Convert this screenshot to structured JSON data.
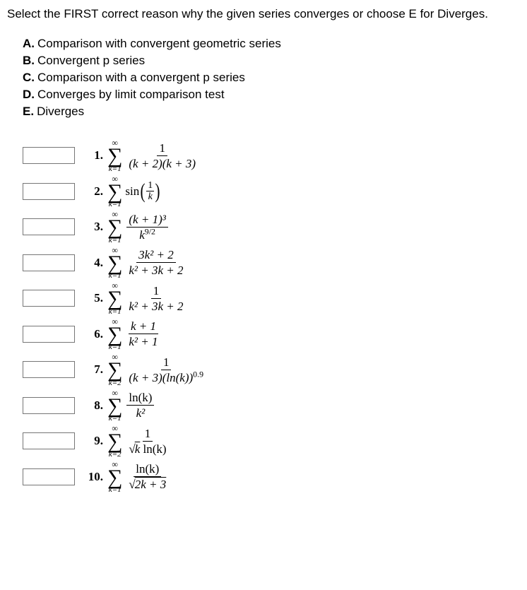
{
  "prompt": "Select the FIRST correct reason why the given series converges or choose E for Diverges.",
  "options": {
    "A": {
      "letter": "A.",
      "text": "Comparison with convergent geometric series"
    },
    "B": {
      "letter": "B.",
      "text": "Convergent p series"
    },
    "C": {
      "letter": "C.",
      "text": "Comparison with a convergent p series"
    },
    "D": {
      "letter": "D.",
      "text": "Converges by limit comparison test"
    },
    "E": {
      "letter": "E.",
      "text": "Diverges"
    }
  },
  "sigma": {
    "inf": "∞",
    "sym": "∑",
    "k1": "k=1",
    "k2": "k=2"
  },
  "labels": {
    "1": "1.",
    "2": "2.",
    "3": "3.",
    "4": "4.",
    "5": "5.",
    "6": "6.",
    "7": "7.",
    "8": "8.",
    "9": "9.",
    "10": "10."
  },
  "expr": {
    "1": {
      "num": "1",
      "den": "(k + 2)(k + 3)"
    },
    "2": {
      "fn": "sin",
      "inner_num": "1",
      "inner_den": "k"
    },
    "3": {
      "num": "(k + 1)³",
      "den_base": "k",
      "den_exp": "9/2"
    },
    "4": {
      "num": "3k² + 2",
      "den": "k² + 3k + 2"
    },
    "5": {
      "num": "1",
      "den": "k² + 3k + 2"
    },
    "6": {
      "num": "k + 1",
      "den": "k² + 1"
    },
    "7": {
      "num": "1",
      "den_a": "(k + 3)(ln(k))",
      "den_exp": "0.9"
    },
    "8": {
      "num": "ln(k)",
      "den": "k²"
    },
    "9": {
      "num": "1",
      "den_rad": "√",
      "den_a": "k",
      "den_b": " ln(k)"
    },
    "10": {
      "num": "ln(k)",
      "den_rad": "√",
      "den_in": "2k + 3"
    }
  }
}
